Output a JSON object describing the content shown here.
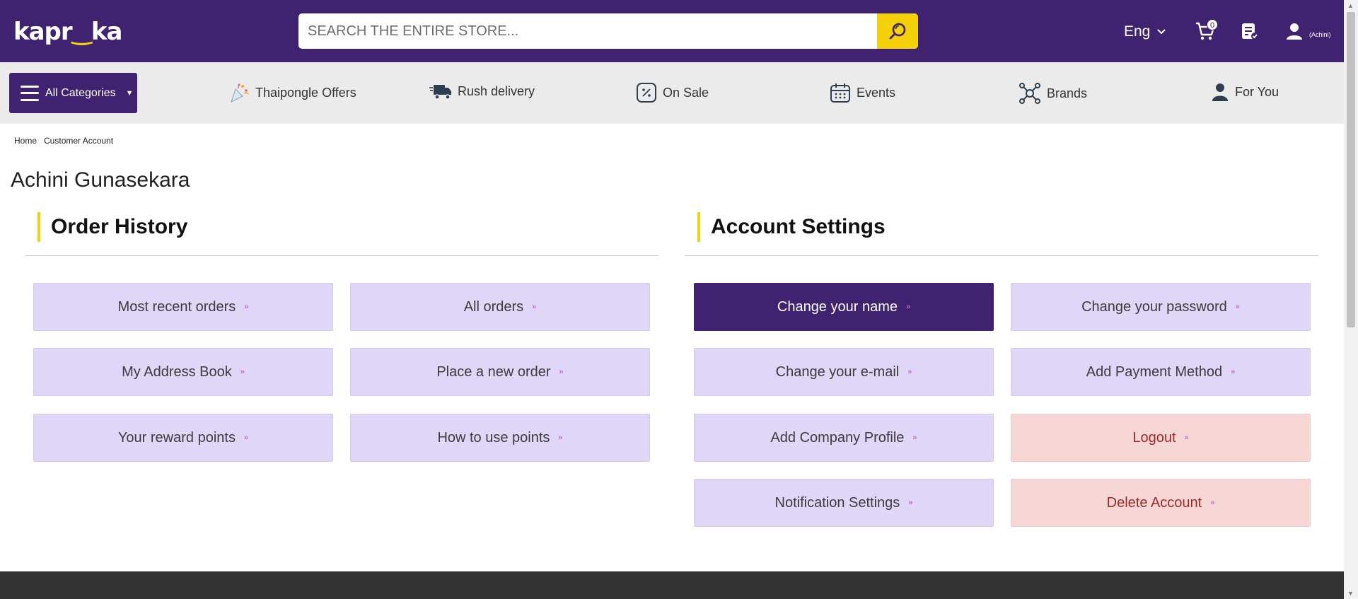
{
  "header": {
    "logo": {
      "before": "kapr",
      "smile": "‿",
      "after": "ka"
    },
    "search_placeholder": "SEARCH THE ENTIRE STORE...",
    "language": "Eng",
    "cart_count": "0",
    "user_label": "(Achini)"
  },
  "nav": {
    "all_categories": "All Categories",
    "items": [
      {
        "label": "Thaipongle Offers"
      },
      {
        "label": "Rush delivery"
      },
      {
        "label": "On Sale"
      },
      {
        "label": "Events"
      },
      {
        "label": "Brands"
      },
      {
        "label": "For You"
      }
    ]
  },
  "breadcrumb": [
    "Home",
    "Customer Account"
  ],
  "page_title": "Achini Gunasekara",
  "order_history": {
    "title": "Order History",
    "tiles": [
      "Most recent orders",
      "All orders",
      "My Address Book",
      "Place a new order",
      "Your reward points",
      "How to use points"
    ]
  },
  "account_settings": {
    "title": "Account Settings",
    "tiles": [
      "Change your name",
      "Change your password",
      "Change your e-mail",
      "Add Payment Method",
      "Add Company Profile",
      "Logout",
      "Notification Settings",
      "Delete Account"
    ]
  },
  "tile_arrow": "»",
  "colors": {
    "brand_purple": "#3f2270",
    "accent_yellow": "#f5d10c",
    "tile_lavender": "#e0d6f7",
    "tile_danger": "#f7d6d6",
    "danger_text": "#a02929"
  }
}
